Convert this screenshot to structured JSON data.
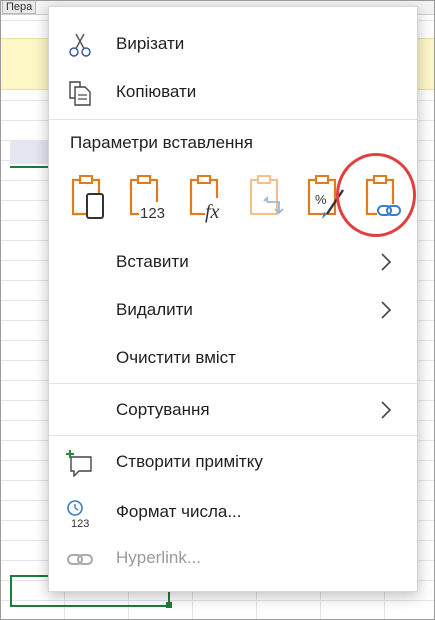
{
  "background": {
    "col_header_label": "Пера"
  },
  "menu": {
    "cut_label": "Вирізати",
    "copy_label": "Копіювати",
    "paste_options_title": "Параметри вставлення",
    "insert_label": "Вставити",
    "delete_label": "Видалити",
    "clear_label": "Очистити вміст",
    "sort_label": "Сортування",
    "new_comment_label": "Створити примітку",
    "number_format_label": "Формат числа...",
    "hyperlink_label": "Hyperlink...",
    "paste_options": [
      {
        "name": "paste",
        "icon": "clipboard-icon"
      },
      {
        "name": "paste-values",
        "icon": "clipboard-123-icon"
      },
      {
        "name": "paste-formulas",
        "icon": "clipboard-fx-icon"
      },
      {
        "name": "paste-transpose",
        "icon": "clipboard-transpose-icon"
      },
      {
        "name": "paste-formatting",
        "icon": "clipboard-brush-icon"
      },
      {
        "name": "paste-link",
        "icon": "clipboard-link-icon"
      }
    ],
    "number_format_icon_text": "123"
  },
  "colors": {
    "accent_orange": "#e07b20",
    "highlight_circle": "#e04040",
    "selection_green": "#1f7a3b"
  }
}
